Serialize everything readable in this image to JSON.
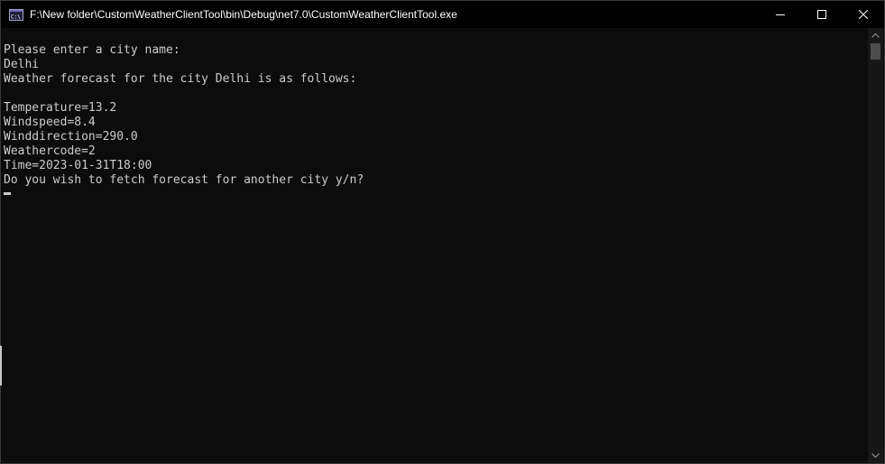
{
  "window": {
    "title": "F:\\New folder\\CustomWeatherClientTool\\bin\\Debug\\net7.0\\CustomWeatherClientTool.exe",
    "icon": "console-app-icon",
    "controls": [
      "minimize-icon",
      "maximize-icon",
      "close-icon"
    ]
  },
  "console": {
    "lines": [
      "Please enter a city name:",
      "Delhi",
      "Weather forecast for the city Delhi is as follows:",
      "",
      "Temperature=13.2",
      "Windspeed=8.4",
      "Winddirection=290.0",
      "Weathercode=2",
      "Time=2023-01-31T18:00",
      "Do you wish to fetch forecast for another city y/n?"
    ],
    "text_color": "#cccccc",
    "background_color": "#0c0c0c"
  }
}
